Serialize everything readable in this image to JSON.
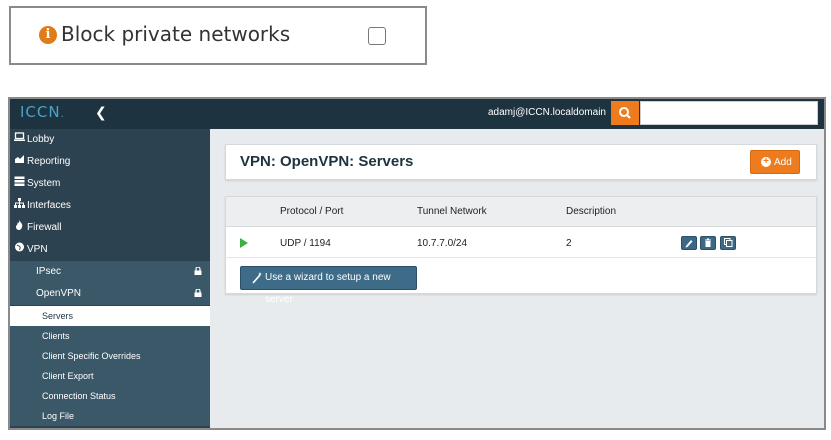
{
  "callout": {
    "icon": "info-icon",
    "icon_glyph": "i",
    "label": "Block private networks",
    "checked": false
  },
  "topbar": {
    "logo": "ICCN",
    "logo_suffix": ".",
    "collapse_glyph": "❮",
    "user": "adamj@ICCN.localdomain",
    "search_placeholder": ""
  },
  "sidebar": {
    "items": [
      {
        "label": "Lobby",
        "icon": "laptop-icon"
      },
      {
        "label": "Reporting",
        "icon": "area-chart-icon"
      },
      {
        "label": "System",
        "icon": "server-icon"
      },
      {
        "label": "Interfaces",
        "icon": "sitemap-icon"
      },
      {
        "label": "Firewall",
        "icon": "fire-icon"
      },
      {
        "label": "VPN",
        "icon": "globe-icon"
      }
    ],
    "vpn_subitems": [
      {
        "label": "IPsec",
        "icon": "lock-icon"
      },
      {
        "label": "OpenVPN",
        "icon": "lock-icon"
      }
    ],
    "openvpn_subitems": [
      {
        "label": "Servers",
        "active": true
      },
      {
        "label": "Clients"
      },
      {
        "label": "Client Specific Overrides"
      },
      {
        "label": "Client Export"
      },
      {
        "label": "Connection Status"
      },
      {
        "label": "Log File"
      }
    ]
  },
  "main": {
    "title": "VPN: OpenVPN: Servers",
    "add_label": "Add",
    "table": {
      "headers": [
        "Protocol / Port",
        "Tunnel Network",
        "Description"
      ],
      "rows": [
        {
          "status": "play-icon",
          "protocol_port": "UDP / 1194",
          "tunnel_network": "10.7.7.0/24",
          "description": "2"
        }
      ]
    },
    "wizard_label": "Use a wizard to setup a new server"
  },
  "colors": {
    "accent_orange": "#ee7c1e",
    "topbar": "#1e3340",
    "sidebar": "#2d4250",
    "sidebar_sub": "#3b5868",
    "button_blue": "#3d6b88",
    "status_green": "#3cb043"
  }
}
